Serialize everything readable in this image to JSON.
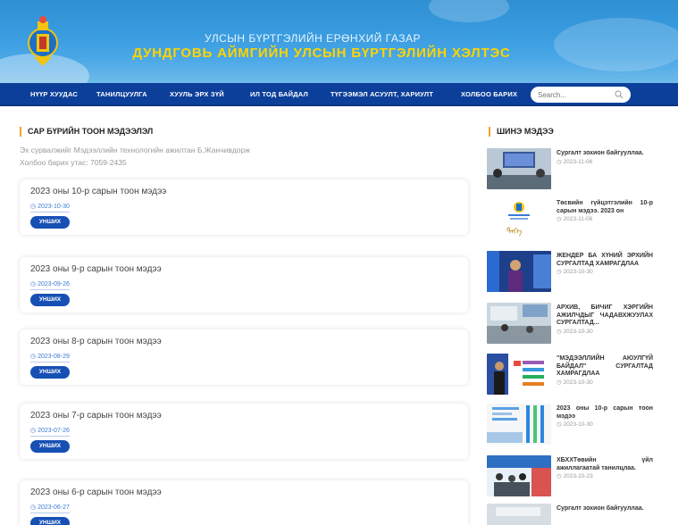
{
  "header": {
    "line1": "УЛСЫН БҮРТГЭЛИЙН ЕРӨНХИЙ ГАЗАР",
    "line2": "ДУНДГОВЬ АЙМГИЙН УЛСЫН БҮРТГЭЛИЙН ХЭЛТЭС"
  },
  "nav": {
    "items": [
      {
        "label": "НҮҮР ХУУДАС"
      },
      {
        "label": "ТАНИЛЦУУЛГА"
      },
      {
        "label": "ХУУЛЬ ЭРХ ЗҮЙ"
      },
      {
        "label": "ИЛ ТОД БАЙДАЛ"
      },
      {
        "label": "ТҮГЭЭМЭЛ АСУУЛТ, ХАРИУЛТ"
      },
      {
        "label": "ХОЛБОО БАРИХ"
      }
    ],
    "search_placeholder": "Search..."
  },
  "main": {
    "title": "САР БҮРИЙН ТООН МЭДЭЭЛЭЛ",
    "source": "Эх сурвалжийг Мэдээллийн технологийн ажилтан Б.Жанчивдорж",
    "contact": "Холбоо барих утас: 7059-2435",
    "read_label": "УНШИХ",
    "cards": [
      {
        "title": "2023 оны 10-р сарын тоон мэдээ",
        "date": "2023-10-30"
      },
      {
        "title": "2023 оны 9-р сарын тоон мэдээ",
        "date": "2023-09-26"
      },
      {
        "title": "2023 оны 8-р сарын тоон мэдээ",
        "date": "2023-08-29"
      },
      {
        "title": "2023 оны 7-р сарын тоон мэдээ",
        "date": "2023-07-26"
      },
      {
        "title": "2023 оны 6-р сарын тоон мэдээ",
        "date": "2023-06-27"
      }
    ]
  },
  "sidebar": {
    "title": "ШИНЭ МЭДЭЭ",
    "items": [
      {
        "title": "Сургалт зохион байгууллаа.",
        "date": "2023-11-06"
      },
      {
        "title": "Төсвийн гүйцэтгэлийн 10-р сарын мэдээ. 2023 он",
        "date": "2023-11-06"
      },
      {
        "title": "ЖЕНДЕР БА ХҮНИЙ ЭРХИЙН СУРГАЛТАД ХАМРАГДЛАА",
        "date": "2023-10-30"
      },
      {
        "title": "АРХИВ, БИЧИГ ХЭРГИЙН АЖИЛЧДЫГ ЧАДАВХЖУУЛАХ СУРГАЛТАД...",
        "date": "2023-10-30"
      },
      {
        "title": "\"МЭДЭЭЛЛИЙН АЮУЛГҮЙ БАЙДАЛ\" СУРГАЛТАД ХАМРАГДЛАА",
        "date": "2023-10-30"
      },
      {
        "title": "2023 оны 10-р сарын тоон мэдээ",
        "date": "2023-10-30"
      },
      {
        "title": "ХБХХТөвийн үйл ажиллагаатай танилцлаа.",
        "date": "2023-10-23"
      },
      {
        "title": "Сургалт зохион байгууллаа.",
        "date": ""
      }
    ]
  },
  "colors": {
    "nav_bg": "#0c3f9a",
    "header_title_yellow": "#ffd400",
    "button_blue": "#1750b5",
    "accent_orange": "#f5a623"
  }
}
